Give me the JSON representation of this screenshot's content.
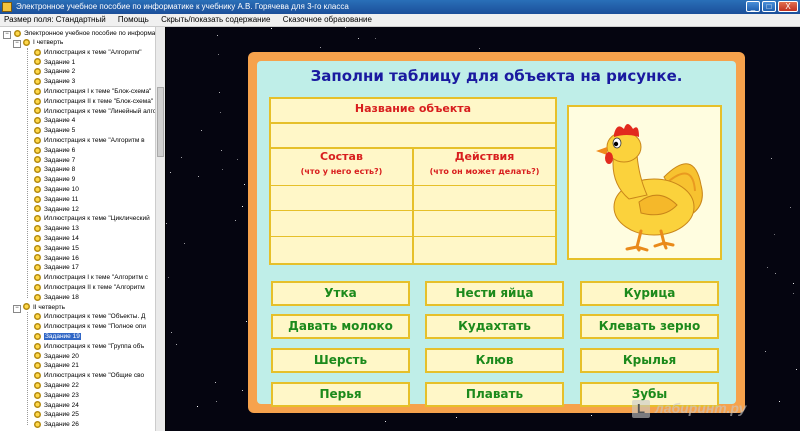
{
  "window": {
    "title": "Электронное учебное пособие по информатике к учебнику А.В. Горячева для 3-го класса",
    "buttons": {
      "minimize": "_",
      "maximize": "□",
      "close": "X"
    }
  },
  "menu": [
    "Размер поля: Стандартный",
    "Помощь",
    "Скрыть/показать содержание",
    "Сказочное образование"
  ],
  "tree": {
    "root": "Электронное учебное пособие по информатике. 3",
    "groups": [
      {
        "label": "I четверть",
        "items": [
          "Иллюстрация к теме \"Алгоритм\"",
          "Задание 1",
          "Задание 2",
          "Задание 3",
          "Иллюстрация I к теме \"Блок-схема\"",
          "Иллюстрация II к теме \"Блок-схема\"",
          "Иллюстрация к теме \"Линейный алгоритм\"",
          "Задание 4",
          "Задание 5",
          "Иллюстрация к теме \"Алгоритм в",
          "Задание 6",
          "Задание 7",
          "Задание 8",
          "Задание 9",
          "Задание 10",
          "Задание 11",
          "Задание 12",
          "Иллюстрация к теме \"Циклический",
          "Задание 13",
          "Задание 14",
          "Задание 15",
          "Задание 16",
          "Задание 17",
          "Иллюстрация I к теме \"Алгоритм с",
          "Иллюстрация II к теме \"Алгоритм",
          "Задание 18"
        ]
      },
      {
        "label": "II четверть",
        "items": [
          "Иллюстрация к теме \"Объекты. Д",
          "Иллюстрация к теме \"Полное опи",
          "Задание 19",
          "Иллюстрация к теме \"Группа объ",
          "Задание 20",
          "Задание 21",
          "Иллюстрация к теме \"Общие сво",
          "Задание 22",
          "Задание 23",
          "Задание 24",
          "Задание 25",
          "Задание 26"
        ]
      }
    ],
    "selected": "Задание 19"
  },
  "task": {
    "heading": "Заполни таблицу для объекта на рисунке.",
    "col_name": "Название объекта",
    "col_parts": "Состав",
    "col_parts_sub": "(что у него есть?)",
    "col_actions": "Действия",
    "col_actions_sub": "(что он может делать?)"
  },
  "answers": [
    [
      "Утка",
      "Нести яйца",
      "Курица"
    ],
    [
      "Давать молоко",
      "Кудахтать",
      "Клевать зерно"
    ],
    [
      "Шерсть",
      "Клюв",
      "Крылья"
    ],
    [
      "Перья",
      "Плавать",
      "Зубы"
    ]
  ],
  "picture": {
    "icon": "chicken-illustration"
  },
  "watermark": {
    "logo": "L",
    "text": "лабиринт.ру"
  },
  "colors": {
    "board": "#f6a24c",
    "panel": "#bfeee8",
    "heading": "#1a1aa0",
    "header_text": "#d81e1e",
    "answer_text": "#1c8a1c"
  }
}
